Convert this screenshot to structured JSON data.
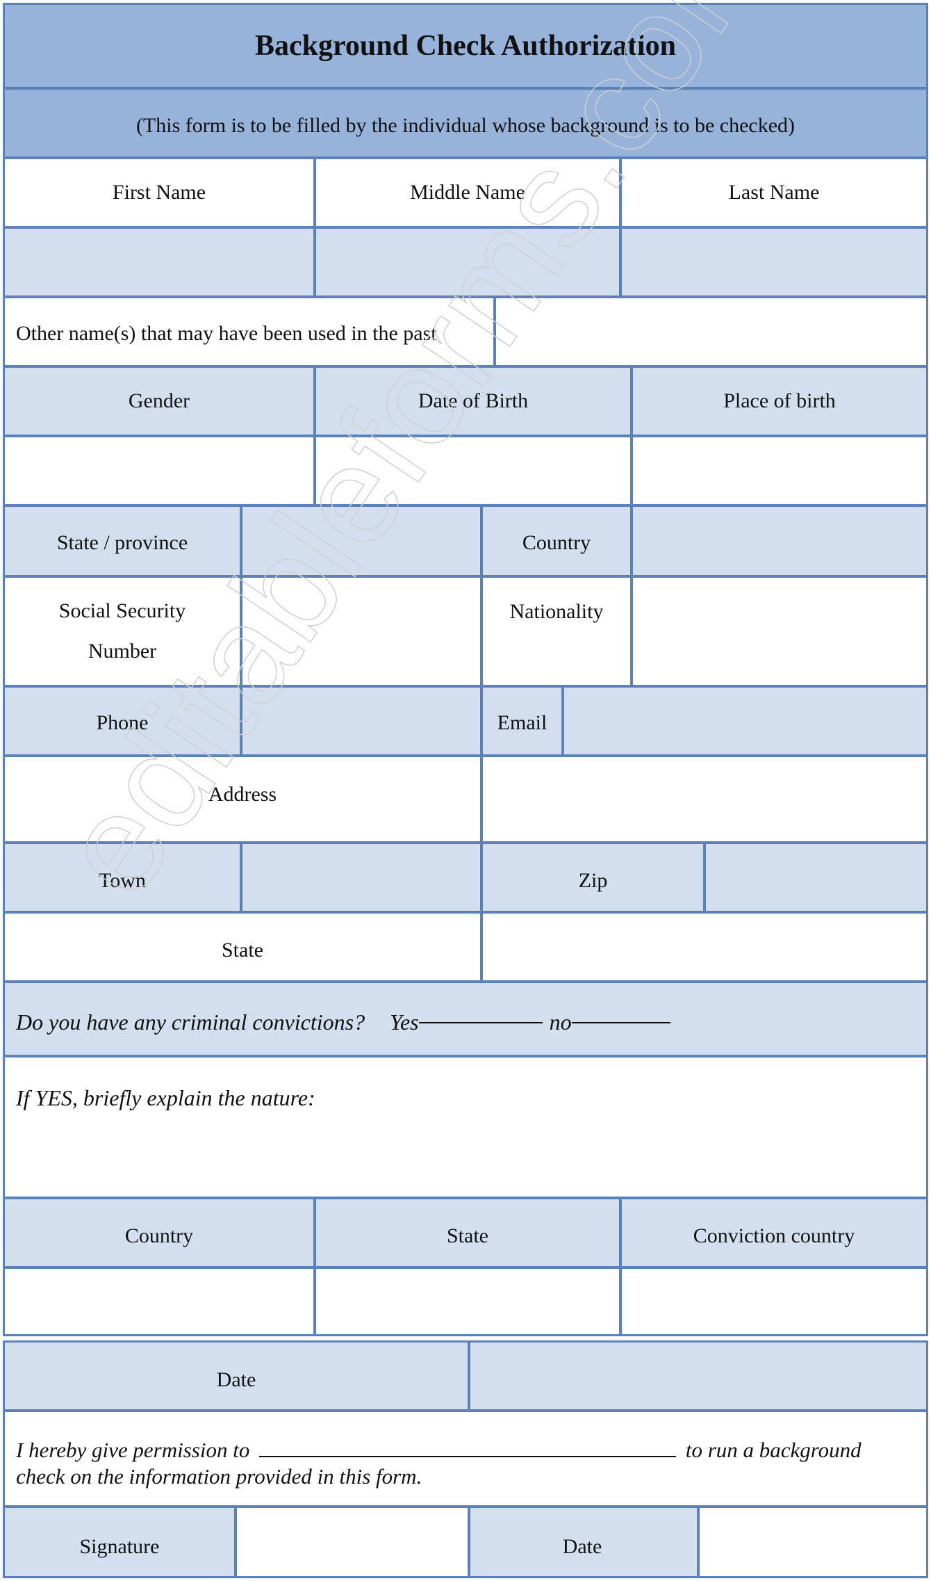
{
  "form": {
    "title": "Background Check Authorization",
    "subtitle": "(This form is to be filled by the individual whose background is to be checked)",
    "name_labels": [
      "First Name",
      "Middle Name",
      "Last Name"
    ],
    "other_names_label": "Other name(s) that may have been used in the past",
    "birth_labels": [
      "Gender",
      "Date of Birth",
      "Place of birth"
    ],
    "state_province_label": "State / province",
    "country_label": "Country",
    "ssn_label_line1": "Social Security",
    "ssn_label_line2": "Number",
    "nationality_label": "Nationality",
    "phone_label": "Phone",
    "email_label": "Email",
    "address_label": "Address",
    "town_label": "Town",
    "zip_label": "Zip",
    "state_label": "State",
    "criminal_question": "Do you have any criminal convictions?",
    "yes_label": "Yes",
    "no_label": "no",
    "explain_label": "If YES, briefly explain the nature:",
    "conviction_labels": [
      "Country",
      "State",
      "Conviction country"
    ],
    "date_label": "Date",
    "permission_part1": "I hereby give permission to",
    "permission_part2": "to run a background",
    "permission_line2": "check on the information provided in this form.",
    "signature_label": "Signature",
    "signature_date_label": "Date"
  },
  "watermark": "editableforms.com",
  "colors": {
    "header_bg": "#97b3d9",
    "light_bg": "#d3dfee",
    "border": "#5b82b8"
  }
}
